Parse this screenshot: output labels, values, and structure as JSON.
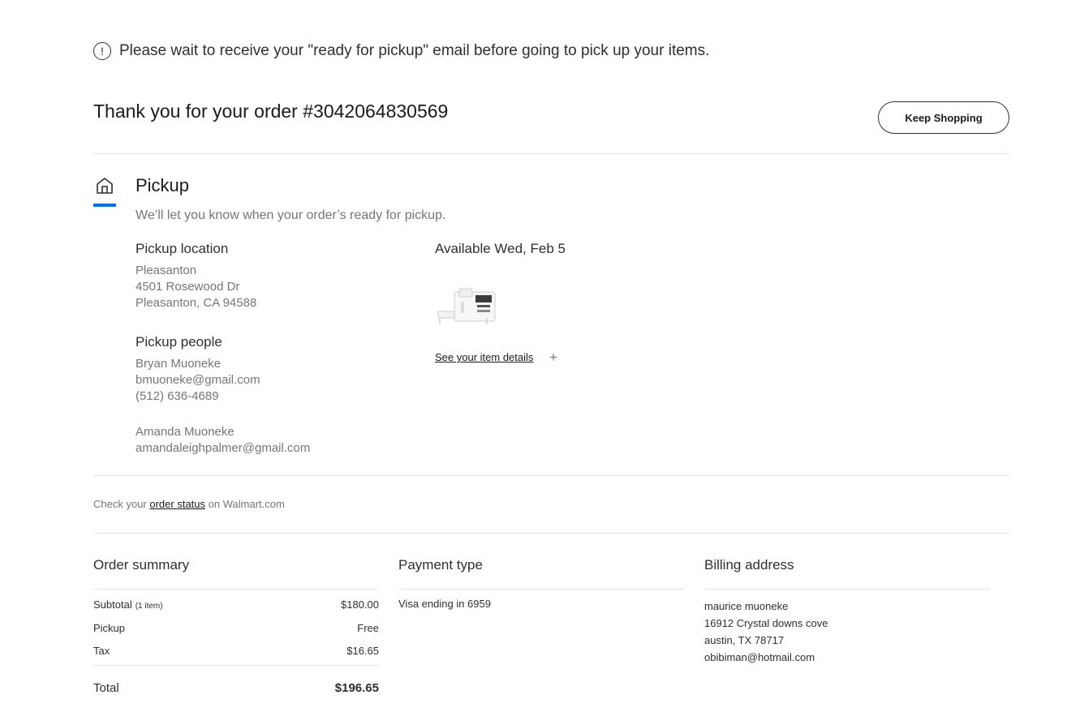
{
  "notice": {
    "text": "Please wait to receive your \"ready for pickup\" email before going to pick up your items."
  },
  "header": {
    "thanks": "Thank you for your order #3042064830569",
    "keep_shopping": "Keep Shopping"
  },
  "pickup": {
    "title": "Pickup",
    "subtitle": "We’ll let you know when your order’s ready for pickup.",
    "location": {
      "heading": "Pickup location",
      "lines": [
        "Pleasanton",
        "4501 Rosewood Dr",
        "Pleasanton, CA 94588"
      ]
    },
    "people": {
      "heading": "Pickup people",
      "person1": [
        "Bryan Muoneke",
        "bmuoneke@gmail.com",
        "(512) 636-4689"
      ],
      "person2": [
        "Amanda Muoneke",
        "amandaleighpalmer@gmail.com"
      ]
    },
    "availability": "Available Wed, Feb 5",
    "item_link": "See your item details",
    "plus": "+"
  },
  "status": {
    "prefix": "Check your",
    "link": "order status",
    "suffix": "on Walmart.com"
  },
  "summary": {
    "heading": "Order summary",
    "subtotal_label": "Subtotal",
    "subtotal_count": "(1 item)",
    "subtotal_value": "$180.00",
    "pickup_label": "Pickup",
    "pickup_value": "Free",
    "tax_label": "Tax",
    "tax_value": "$16.65",
    "total_label": "Total",
    "total_value": "$196.65"
  },
  "payment": {
    "heading": "Payment type",
    "text": "Visa ending in 6959"
  },
  "billing": {
    "heading": "Billing address",
    "lines": [
      "maurice muoneke",
      "16912 Crystal downs cove",
      "austin, TX 78717",
      "obibiman@hotmail.com"
    ]
  },
  "colors": {
    "accent": "#0071dc",
    "text": "#2e2f32",
    "muted": "#74767c",
    "divider": "#e3e4e5"
  }
}
